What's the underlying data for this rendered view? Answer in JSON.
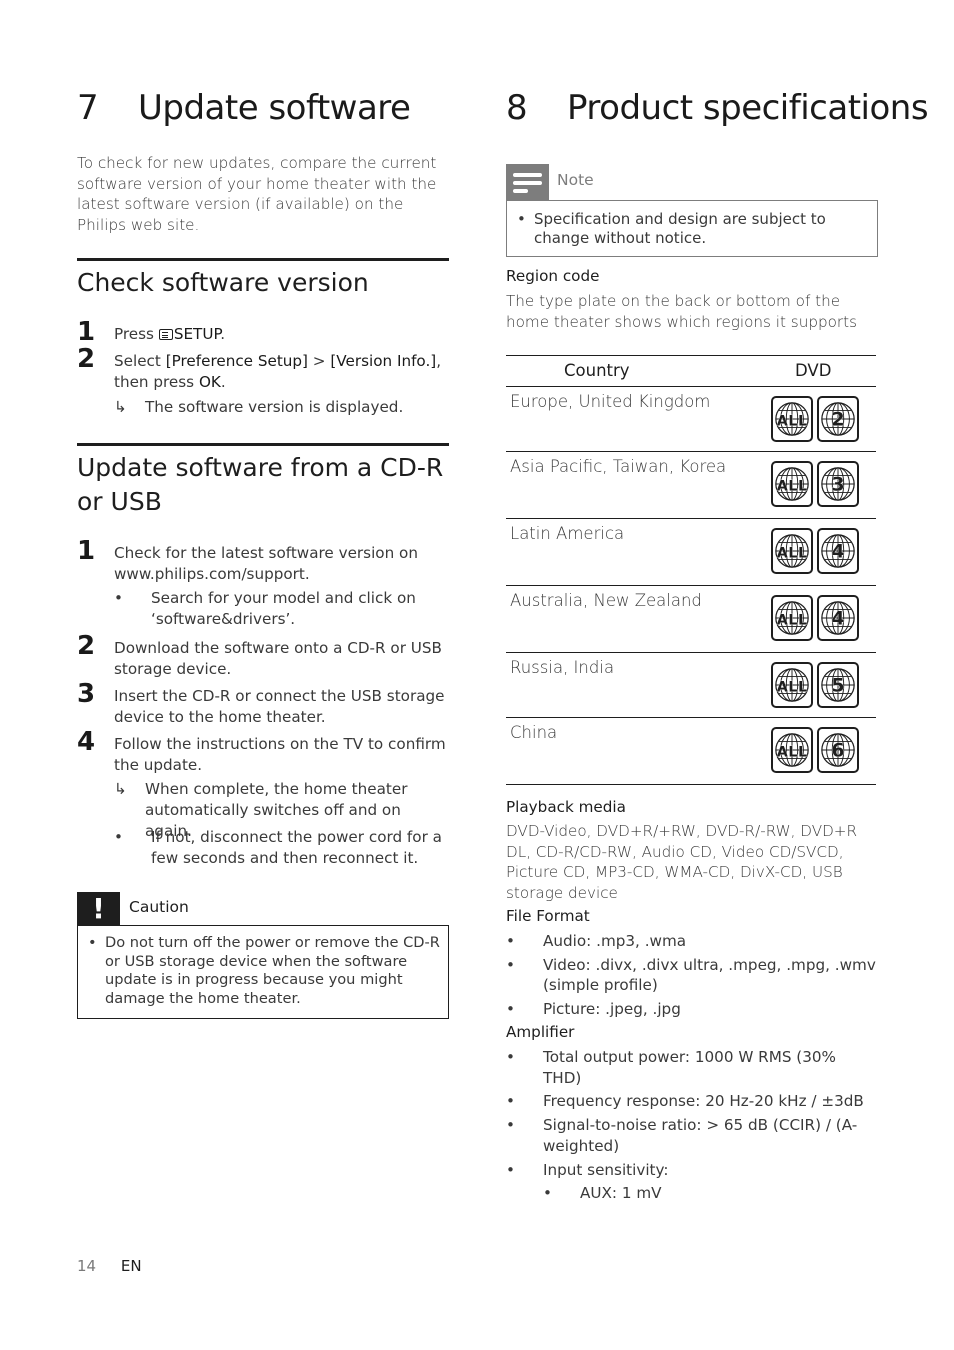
{
  "left": {
    "chapter": {
      "number": "7",
      "title": "Update software"
    },
    "intro": "To check for new updates, compare the current software version of your home theater with the latest software version (if available) on the Philips web site.",
    "check_section": {
      "heading": "Check software version",
      "steps": [
        {
          "num": "1",
          "pre": "Press ",
          "icon": "setup-icon",
          "bold": "SETUP",
          "post": "."
        },
        {
          "num": "2",
          "pre": "Select ",
          "bold1": "[Preference Setup]",
          "mid": " > ",
          "bold2": "[Version Info.]",
          "mid2": ", then press ",
          "bold3": "OK",
          "post": "."
        }
      ],
      "result_marker": "↳",
      "result": "The software version is displayed."
    },
    "update_section": {
      "heading": "Update software from a CD-R or USB",
      "steps": [
        {
          "num": "1",
          "text": "Check for the latest software version on www.philips.com/support."
        },
        {
          "num": "2",
          "text": "Download the software onto a CD-R or USB storage device."
        },
        {
          "num": "3",
          "text": "Insert the CD-R or connect the USB storage device to the home theater."
        },
        {
          "num": "4",
          "text": "Follow the instructions on the TV to confirm the update."
        }
      ],
      "step1_bullet": "Search for your model and click on ‘software&drivers’.",
      "step4_result": "When complete, the home theater automatically switches off and on again.",
      "step4_bullet": "If not, disconnect the power cord for a few seconds and then reconnect it.",
      "bullet_marker": "•",
      "result_marker": "↳"
    },
    "caution": {
      "icon_glyph": "!",
      "title": "Caution",
      "text": "Do not turn off the power or remove the CD-R or USB storage device when the software update is in progress because you might damage the home theater."
    }
  },
  "right": {
    "chapter": {
      "number": "8",
      "title": "Product specifications"
    },
    "note": {
      "title": "Note",
      "text": "Specification and design are subject to change without notice."
    },
    "region_code": {
      "label": "Region code",
      "text": "The type plate on the back or bottom of the home theater shows which regions it supports",
      "table": {
        "headers": [
          "Country",
          "DVD"
        ],
        "rows": [
          {
            "country": "Europe, United Kingdom",
            "codes": [
              "ALL",
              "2"
            ]
          },
          {
            "country": "Asia Pacific, Taiwan, Korea",
            "codes": [
              "ALL",
              "3"
            ]
          },
          {
            "country": "Latin America",
            "codes": [
              "ALL",
              "4"
            ]
          },
          {
            "country": "Australia, New Zealand",
            "codes": [
              "ALL",
              "4"
            ]
          },
          {
            "country": "Russia, India",
            "codes": [
              "ALL",
              "5"
            ]
          },
          {
            "country": "China",
            "codes": [
              "ALL",
              "6"
            ]
          }
        ]
      }
    },
    "playback_media": {
      "label": "Playback media",
      "text": "DVD-Video, DVD+R/+RW, DVD-R/-RW, DVD+R DL, CD-R/CD-RW, Audio CD, Video CD/SVCD, Picture CD, MP3-CD, WMA-CD, DivX-CD, USB storage device"
    },
    "file_format": {
      "label": "File Format",
      "items": [
        "Audio: .mp3, .wma",
        "Video: .divx, .divx ultra, .mpeg, .mpg, .wmv (simple profile)",
        "Picture: .jpeg, .jpg"
      ]
    },
    "amplifier": {
      "label": "Amplifier",
      "items": [
        "Total output power: 1000 W RMS (30% THD)",
        "Frequency response: 20 Hz-20 kHz / ±3dB",
        "Signal-to-noise ratio: > 65 dB (CCIR) / (A-weighted)",
        "Input sensitivity:"
      ],
      "sub_items": [
        "AUX: 1 mV"
      ]
    }
  },
  "footer": {
    "page": "14",
    "lang": "EN"
  }
}
